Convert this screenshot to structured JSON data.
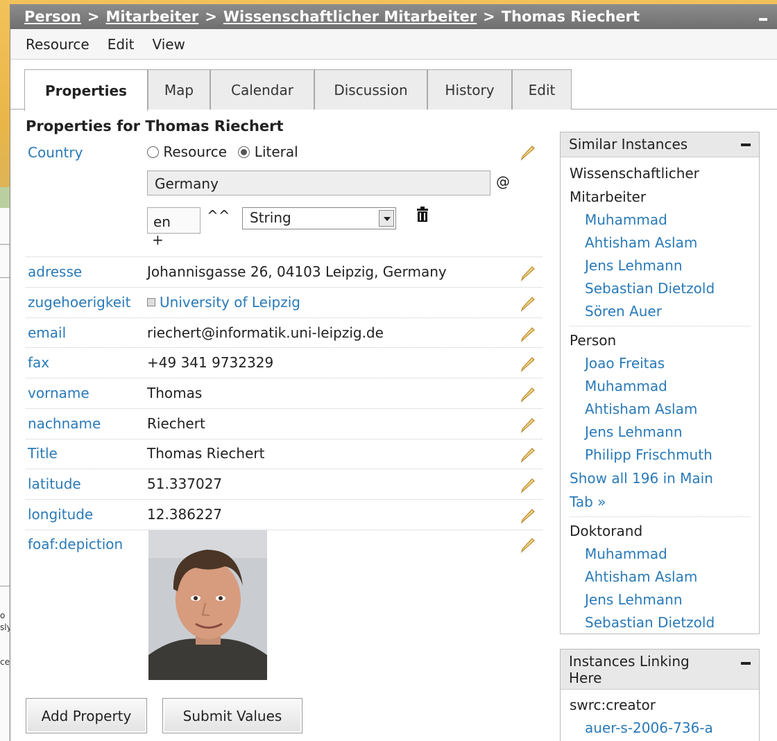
{
  "breadcrumb": {
    "items": [
      "Person",
      "Mitarbeiter",
      "Wissenschaftlicher Mitarbeiter"
    ],
    "current": "Thomas Riechert",
    "separator": ">"
  },
  "menu": [
    "Resource",
    "Edit",
    "View"
  ],
  "tabs": [
    "Properties",
    "Map",
    "Calendar",
    "Discussion",
    "History",
    "Edit"
  ],
  "active_tab": "Properties",
  "heading": "Properties for Thomas Riechert",
  "edit_row": {
    "label": "Country",
    "radio_resource": "Resource",
    "radio_literal": "Literal",
    "selected": "Literal",
    "value": "Germany",
    "at_sign": "@",
    "lang": "en",
    "caret": "^^",
    "datatype": "String",
    "add_symbol": "+"
  },
  "properties": [
    {
      "label": "adresse",
      "value": "Johannisgasse 26, 04103 Leipzig, Germany"
    },
    {
      "label": "zugehoerigkeit",
      "value": "University of Leipzig",
      "is_link": true
    },
    {
      "label": "email",
      "value": "riechert@informatik.uni-leipzig.de"
    },
    {
      "label": "fax",
      "value": "+49 341 9732329"
    },
    {
      "label": "vorname",
      "value": "Thomas"
    },
    {
      "label": "nachname",
      "value": "Riechert"
    },
    {
      "label": "Title",
      "value": "Thomas Riechert"
    },
    {
      "label": "latitude",
      "value": "51.337027"
    },
    {
      "label": "longitude",
      "value": "12.386227"
    },
    {
      "label": "foaf:depiction",
      "value": ""
    }
  ],
  "buttons": {
    "add": "Add Property",
    "submit": "Submit Values"
  },
  "similar": {
    "title": "Similar Instances",
    "groups": [
      {
        "name": "Wissenschaftlicher Mitarbeiter",
        "items": [
          "Muhammad",
          "Ahtisham Aslam",
          "Jens Lehmann",
          "Sebastian Dietzold",
          "Sören Auer"
        ]
      },
      {
        "name": "Person",
        "items": [
          "Joao Freitas",
          "Muhammad",
          "Ahtisham Aslam",
          "Jens Lehmann",
          "Philipp Frischmuth"
        ]
      },
      {
        "name": "Doktorand",
        "items": [
          "Muhammad",
          "Ahtisham Aslam",
          "Jens Lehmann",
          "Sebastian Dietzold"
        ]
      }
    ],
    "show_all": "Show all 196 in Main Tab »"
  },
  "linking": {
    "title": "Instances Linking Here",
    "group": "swrc:creator",
    "items": [
      "auer-s-2006-736-a"
    ]
  },
  "background_fragments": [
    "o",
    "sly",
    "ce"
  ],
  "colors": {
    "link": "#2a7ab8",
    "titlebar": "#7a7a7a",
    "background": "#eab84c"
  }
}
